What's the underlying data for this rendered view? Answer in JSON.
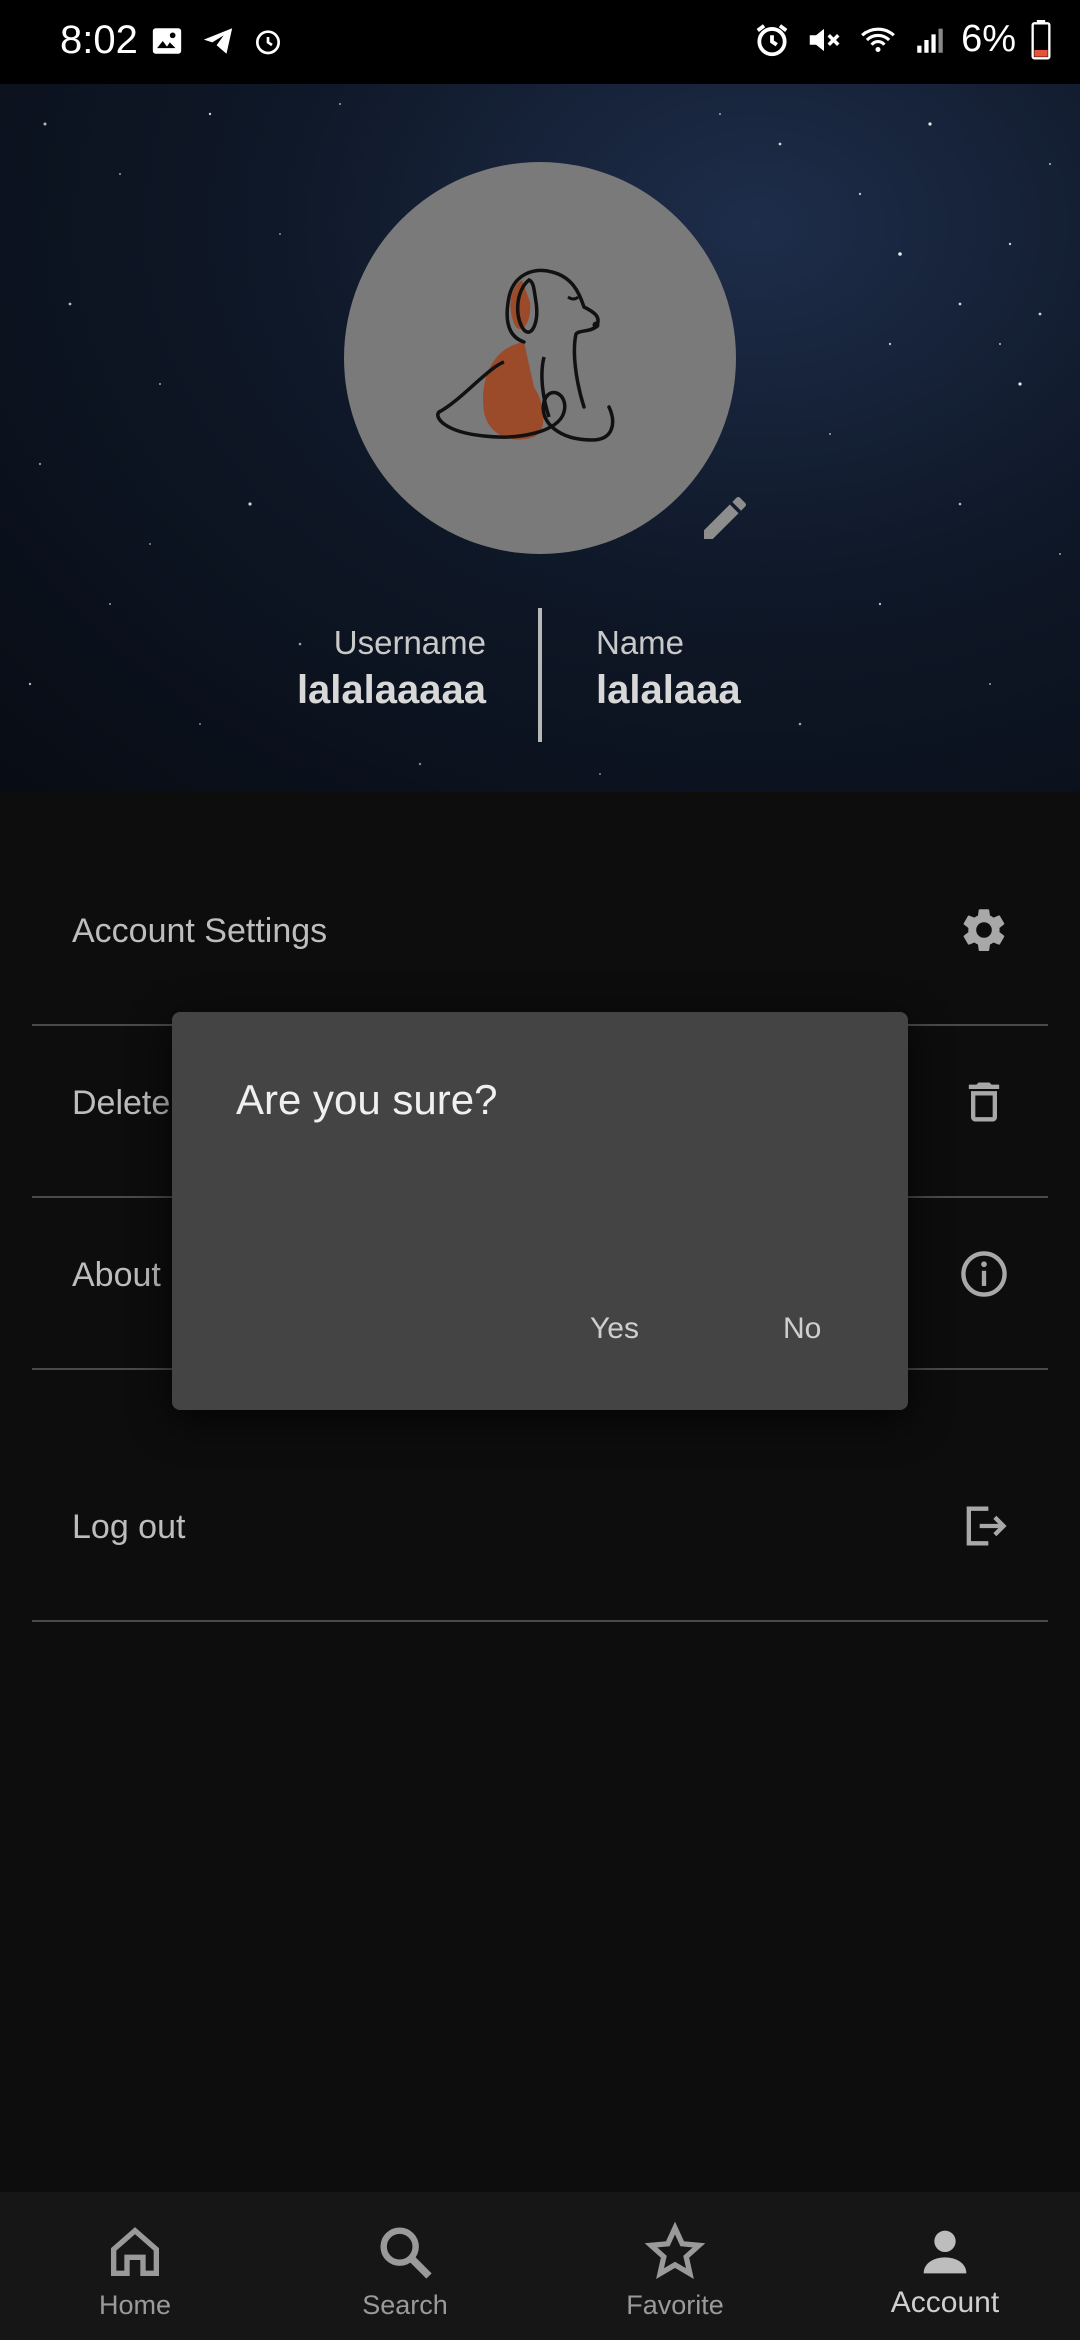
{
  "status_bar": {
    "time": "8:02",
    "battery_percent": "6%",
    "left_icons": [
      "image-icon",
      "telegram-icon",
      "alarm-icon"
    ],
    "right_icons": [
      "alarm-icon",
      "mute-icon",
      "wifi-icon",
      "signal-icon",
      "battery-icon"
    ]
  },
  "profile": {
    "avatar": "dog-illustration",
    "username_label": "Username",
    "username_value": "lalalaaaaa",
    "name_label": "Name",
    "name_value": "lalalaaa"
  },
  "menu": {
    "items": [
      {
        "label": "Account Settings",
        "icon": "gear-icon"
      },
      {
        "label": "Delete",
        "icon": "trash-icon"
      },
      {
        "label": "About",
        "icon": "info-icon"
      },
      {
        "label": "Log out",
        "icon": "logout-icon"
      }
    ]
  },
  "dialog": {
    "title": "Are you sure?",
    "yes_label": "Yes",
    "no_label": "No"
  },
  "bottom_nav": {
    "items": [
      {
        "label": "Home",
        "icon": "home-icon"
      },
      {
        "label": "Search",
        "icon": "search-icon"
      },
      {
        "label": "Favorite",
        "icon": "star-icon"
      },
      {
        "label": "Account",
        "icon": "person-icon",
        "active": true
      }
    ]
  },
  "colors": {
    "background": "#0d0d0d",
    "dialog": "#444444",
    "avatar": "#7a7a7a",
    "dog_spot": "#9b4a2a"
  }
}
